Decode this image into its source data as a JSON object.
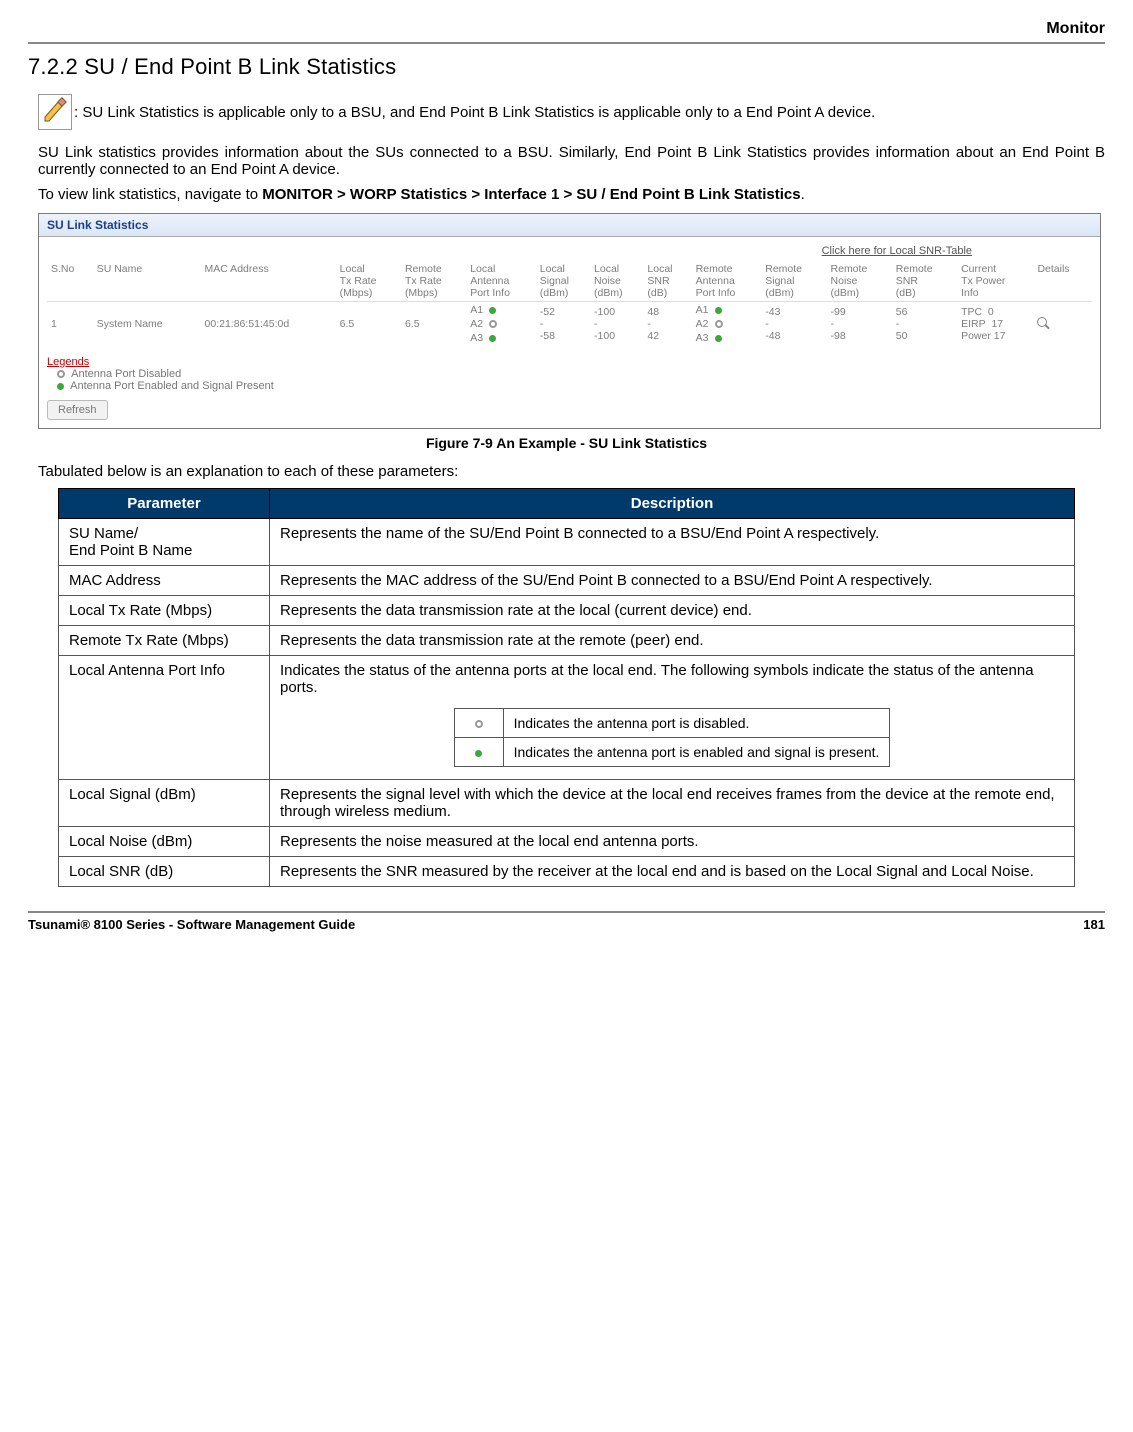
{
  "header": {
    "section": "Monitor"
  },
  "heading": "7.2.2 SU / End Point B Link Statistics",
  "note": ": SU Link Statistics is applicable only to a BSU, and End Point B Link Statistics is applicable only to a End Point A device.",
  "para1": "SU Link statistics provides information about the SUs connected to a BSU. Similarly, End Point B Link Statistics provides information about an End Point B currently connected to an End Point A device.",
  "para2_prefix": "To view link statistics, navigate to ",
  "para2_bold": "MONITOR > WORP Statistics > Interface 1 > SU / End Point B Link Statistics",
  "para2_suffix": ".",
  "panel": {
    "title": "SU Link Statistics",
    "snr_link": "Click here for Local SNR-Table",
    "columns": [
      "S.No",
      "SU Name",
      "MAC Address",
      "Local Tx Rate (Mbps)",
      "Remote Tx Rate (Mbps)",
      "Local Antenna Port Info",
      "Local Signal (dBm)",
      "Local Noise (dBm)",
      "Local SNR (dB)",
      "Remote Antenna Port Info",
      "Remote Signal (dBm)",
      "Remote Noise (dBm)",
      "Remote SNR (dB)",
      "Current Tx Power Info",
      "Details"
    ],
    "row": {
      "sno": "1",
      "su_name": "System Name",
      "mac": "00:21:86:51:45:0d",
      "local_tx": "6.5",
      "remote_tx": "6.5",
      "local_ports": [
        {
          "label": "A1",
          "state": "green"
        },
        {
          "label": "A2",
          "state": "grey"
        },
        {
          "label": "A3",
          "state": "green"
        }
      ],
      "local_signal": [
        "-52",
        "-",
        "-58"
      ],
      "local_noise": [
        "-100",
        "-",
        "-100"
      ],
      "local_snr": [
        "48",
        "-",
        "42"
      ],
      "remote_ports": [
        {
          "label": "A1",
          "state": "green"
        },
        {
          "label": "A2",
          "state": "grey"
        },
        {
          "label": "A3",
          "state": "green"
        }
      ],
      "remote_signal": [
        "-43",
        "-",
        "-48"
      ],
      "remote_noise": [
        "-99",
        "-",
        "-98"
      ],
      "remote_snr": [
        "56",
        "-",
        "50"
      ],
      "txpower": [
        {
          "k": "TPC",
          "v": "0"
        },
        {
          "k": "EIRP",
          "v": "17"
        },
        {
          "k": "Power",
          "v": "17"
        }
      ]
    },
    "legends_header": "Legends",
    "legend_disabled": "Antenna Port Disabled",
    "legend_enabled": "Antenna Port Enabled and Signal Present",
    "refresh": "Refresh"
  },
  "figure_caption": "Figure 7-9 An Example - SU Link Statistics",
  "explain": "Tabulated below is an explanation to each of these parameters:",
  "params_header": {
    "p": "Parameter",
    "d": "Description"
  },
  "params": [
    {
      "p": "SU Name/\nEnd Point B Name",
      "d": "Represents the name of the SU/End Point B connected to a BSU/End Point A respectively."
    },
    {
      "p": "MAC Address",
      "d": "Represents the MAC address of the SU/End Point B connected to a BSU/End Point A respectively."
    },
    {
      "p": "Local Tx Rate (Mbps)",
      "d": "Represents the data transmission rate at the local (current device) end."
    },
    {
      "p": "Remote Tx Rate (Mbps)",
      "d": "Represents the data transmission rate at the remote (peer) end."
    },
    {
      "p": "Local Antenna Port Info",
      "d_intro": "Indicates the status of the antenna ports at the local end. The following symbols indicate the status of the antenna ports.",
      "mini": [
        {
          "icon": "grey",
          "text": "Indicates the antenna port is disabled."
        },
        {
          "icon": "green",
          "text": "Indicates the antenna port is enabled and signal is present."
        }
      ]
    },
    {
      "p": "Local Signal (dBm)",
      "d": "Represents the signal level with which the device at the local end receives frames from the device at the remote end, through wireless medium."
    },
    {
      "p": "Local Noise (dBm)",
      "d": "Represents the noise measured at the local end antenna ports."
    },
    {
      "p": "Local SNR (dB)",
      "d": "Represents the SNR measured by the receiver at the local end and is based on the Local Signal and Local Noise."
    }
  ],
  "footer": {
    "left": "Tsunami® 8100 Series - Software Management Guide",
    "right": "181"
  }
}
